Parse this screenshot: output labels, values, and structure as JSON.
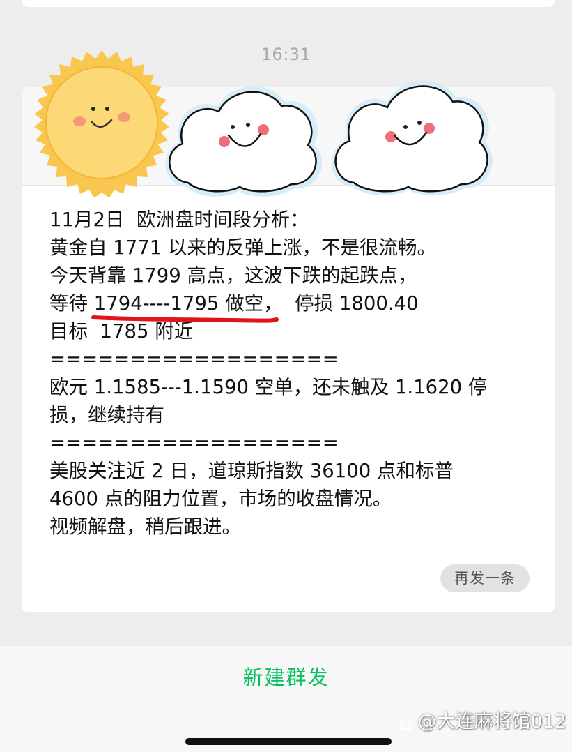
{
  "timestamp": "16:31",
  "message": {
    "lines": {
      "l1": "11月2日  欧洲盘时间段分析：",
      "l2": "黄金自 1771 以来的反弹上涨，不是很流畅。",
      "l3": "今天背靠 1799 高点，这波下跌的起跌点，",
      "l4_prefix": "等待 ",
      "l4_highlight": "1794----1795 做空",
      "l4_suffix": "，  停损 1800.40",
      "l5": "目标  1785 附近",
      "l6": "==================",
      "l7": "欧元 1.1585---1.1590 空单，还未触及 1.1620 停",
      "l8": "损，继续持有",
      "l9": "==================",
      "l10": "美股关注近 2 日，道琼斯指数 36100 点和标普",
      "l11": "4600 点的阻力位置，市场的收盘情况。",
      "l12": "视频解盘，稍后跟进。"
    }
  },
  "resend_label": "再发一条",
  "new_broadcast_label": "新建群发",
  "watermark": "@大连麻将馆012",
  "stickers": [
    "sun-sticker",
    "cloud-sticker",
    "cloud-sticker"
  ],
  "colors": {
    "accent_green": "#07c160",
    "underline_red": "#e0141c",
    "sun": "#f9c74f",
    "cheek": "#f47c7c"
  }
}
